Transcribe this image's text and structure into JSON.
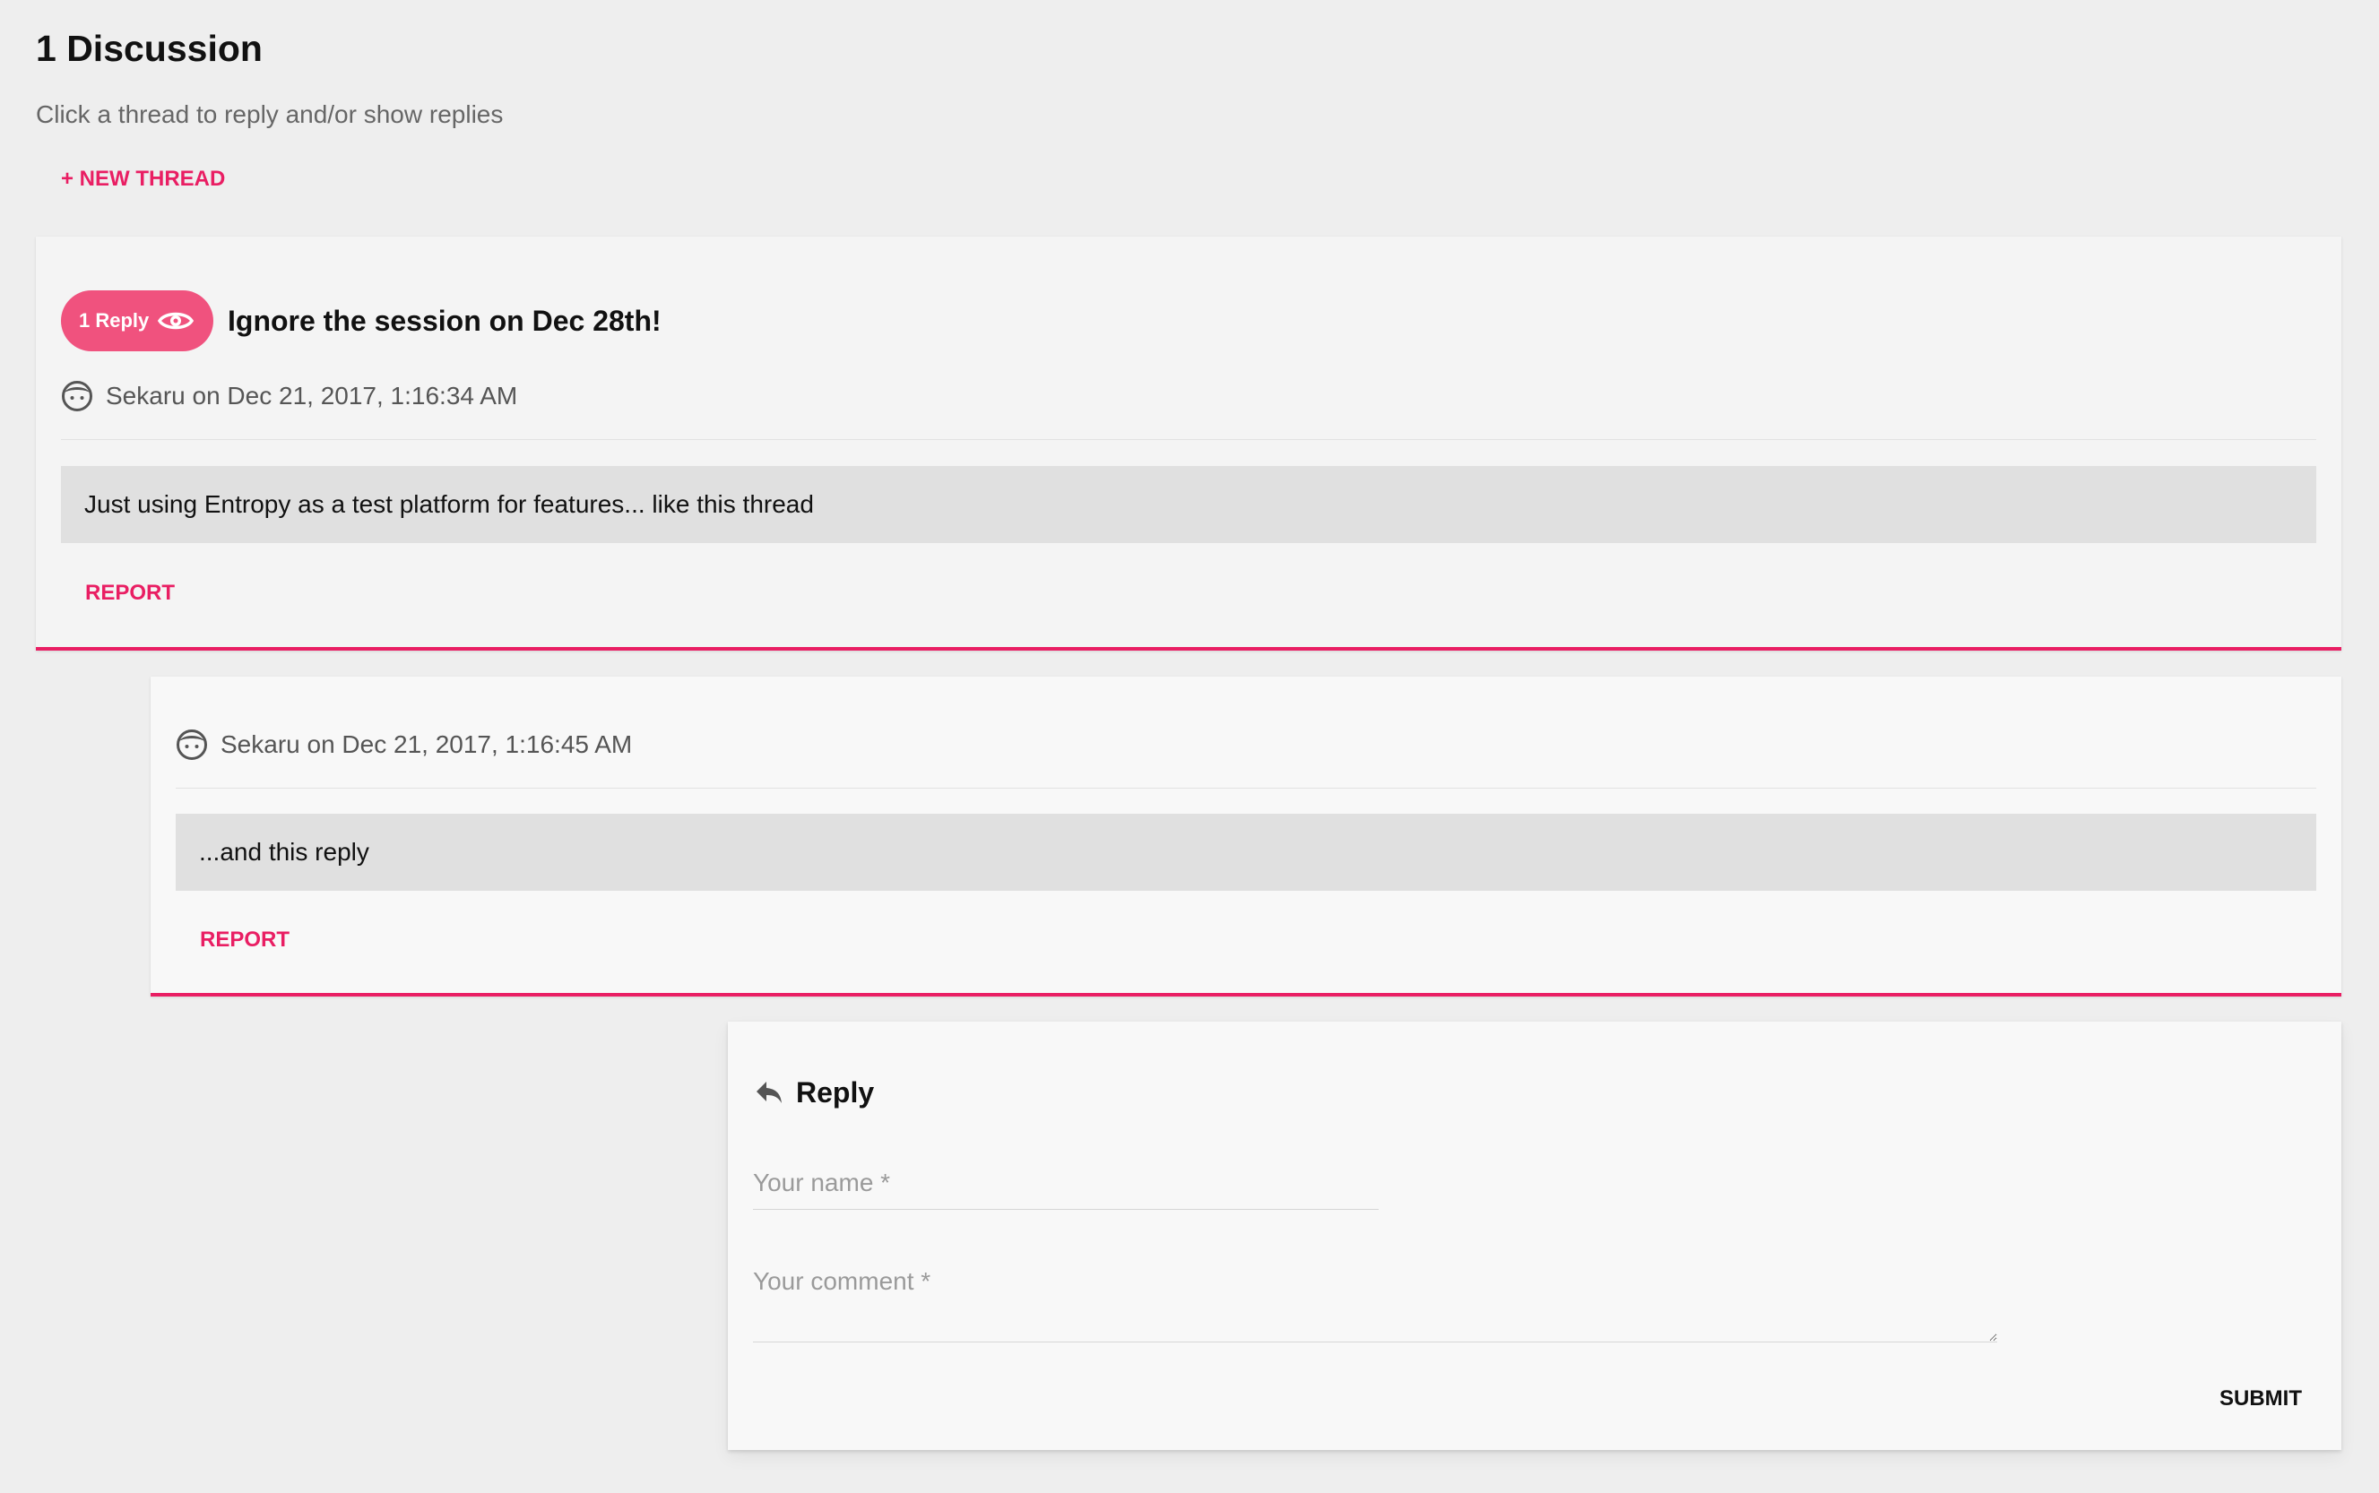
{
  "header": {
    "title": "1 Discussion",
    "subtitle": "Click a thread to reply and/or show replies",
    "new_thread_label": "+ NEW THREAD"
  },
  "thread": {
    "reply_count_label": "1 Reply",
    "title": "Ignore the session on Dec 28th!",
    "author_meta": "Sekaru on Dec 21, 2017, 1:16:34 AM",
    "body": "Just using Entropy as a test platform for features... like this thread",
    "report_label": "REPORT"
  },
  "reply": {
    "author_meta": "Sekaru on Dec 21, 2017, 1:16:45 AM",
    "body": "...and this reply",
    "report_label": "REPORT"
  },
  "reply_form": {
    "title": "Reply",
    "name_placeholder": "Your name *",
    "comment_placeholder": "Your comment *",
    "submit_label": "SUBMIT"
  },
  "icons": {
    "reply_chip": "eye-icon",
    "author": "user-face-icon",
    "form_header": "reply-arrow-icon"
  },
  "colors": {
    "accent": "#e91e63",
    "chip": "#f0527e",
    "background": "#eeeeee",
    "message_box": "#e0e0e0"
  }
}
